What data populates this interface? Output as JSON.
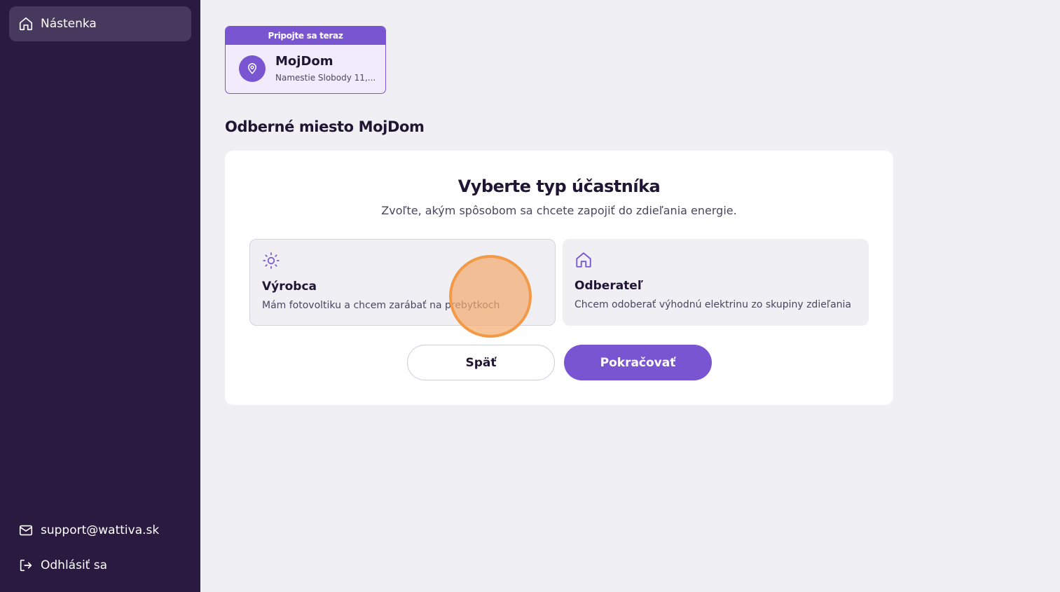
{
  "sidebar": {
    "nav": [
      {
        "label": "Nástenka",
        "icon": "home-icon"
      }
    ],
    "support_email": "support@wattiva.sk",
    "logout_label": "Odhlásiť sa"
  },
  "place_card": {
    "banner": "Pripojte sa teraz",
    "name": "MojDom",
    "address": "Namestie Slobody 11,..."
  },
  "page_title": "Odberné miesto MojDom",
  "panel": {
    "title": "Vyberte typ účastníka",
    "subtitle": "Zvoľte, akým spôsobom sa chcete zapojiť do zdieľania energie.",
    "options": [
      {
        "title": "Výrobca",
        "description": "Mám fotovoltiku a chcem zarábať na prebytkoch",
        "icon": "sun-icon",
        "selected": true
      },
      {
        "title": "Odberateľ",
        "description": "Chcem odoberať výhodnú elektrinu zo skupiny zdieľania",
        "icon": "home-icon",
        "selected": false
      }
    ],
    "back_label": "Späť",
    "continue_label": "Pokračovať"
  },
  "colors": {
    "sidebar_bg": "#2a1a40",
    "accent": "#7a55d2",
    "page_bg": "#f0f0f4",
    "click_marker": "#f29a48"
  }
}
